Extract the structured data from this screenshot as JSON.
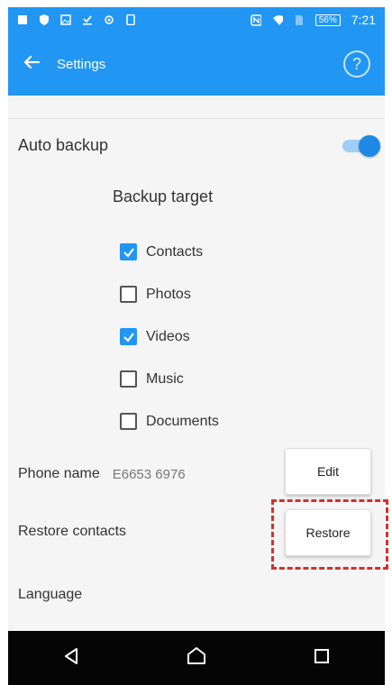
{
  "status_bar": {
    "battery": "56%",
    "time": "7:21",
    "icons": [
      "notification-icon",
      "shield-icon",
      "image-icon",
      "download-icon",
      "circle-icon",
      "phone-icon",
      "nfc-icon",
      "wifi-icon",
      "sim-icon"
    ]
  },
  "app_bar": {
    "title": "Settings",
    "back_icon": "arrow-left-icon",
    "help_icon": "help-circle-icon",
    "help_glyph": "?"
  },
  "settings": {
    "auto_backup": {
      "label": "Auto backup",
      "enabled": true
    },
    "backup_target": {
      "title": "Backup target",
      "items": [
        {
          "label": "Contacts",
          "checked": true
        },
        {
          "label": "Photos",
          "checked": false
        },
        {
          "label": "Videos",
          "checked": true
        },
        {
          "label": "Music",
          "checked": false
        },
        {
          "label": "Documents",
          "checked": false
        }
      ]
    },
    "phone_name": {
      "label": "Phone name",
      "value": "E6653 6976",
      "button": "Edit"
    },
    "restore_contacts": {
      "label": "Restore contacts",
      "button": "Restore"
    },
    "language": {
      "label": "Language"
    }
  },
  "colors": {
    "primary": "#2196f3",
    "toggle_thumb": "#1e88e5",
    "highlight": "#d32f2f",
    "navbar": "#050505"
  },
  "nav_bar": [
    "back-triangle-icon",
    "home-icon",
    "recents-square-icon"
  ]
}
